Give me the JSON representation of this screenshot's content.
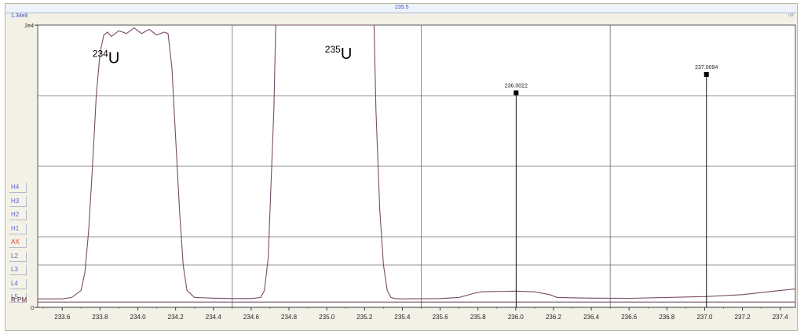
{
  "header": {
    "cursor_mass": "235.5",
    "max_intensity": "1.34e8",
    "corner_mark": "u8"
  },
  "channels": [
    "H4",
    "H3",
    "H2",
    "H1",
    "AX",
    "L2",
    "L3",
    "L4",
    "L5"
  ],
  "rpm_label": "R PM",
  "colors": {
    "trace": "#7a4a6a",
    "peak_line": "#111111",
    "grid": "#6f6f6f",
    "channel_text": "#5a63c9",
    "ax_text": "#e23a2a",
    "label_blue": "#3a4fc6"
  },
  "chart_data": {
    "type": "line",
    "xlabel": "",
    "ylabel": "",
    "xlim": [
      233.47,
      237.48
    ],
    "ylim": [
      0,
      20000.0
    ],
    "y_ticks": [
      {
        "value": 0,
        "label": "0"
      },
      {
        "value": 20000,
        "label": "2e4"
      }
    ],
    "x_ticks": [
      233.6,
      233.8,
      234.0,
      234.2,
      234.4,
      234.6,
      234.8,
      235.0,
      235.2,
      235.4,
      235.6,
      235.8,
      236.0,
      236.2,
      236.4,
      236.6,
      236.8,
      237.0,
      237.2,
      237.4
    ],
    "x_tick_labels": [
      "233.6",
      "233.8",
      "234.0",
      "234.2",
      "234.4",
      "234.6",
      "234.8",
      "235.0",
      "235.2",
      "235.4",
      "235.6",
      "235.8",
      "236.0",
      "236.2",
      "236.4",
      "236.6",
      "236.8",
      "237.0",
      "237.2",
      "237.4"
    ],
    "vertical_grid": [
      234.5,
      235.5,
      236.5
    ],
    "horizontal_grid": [
      3000,
      5000,
      10000,
      15000
    ],
    "grid": true,
    "series": [
      {
        "x": [
          233.47,
          233.6,
          233.65,
          233.7,
          233.72,
          233.74,
          233.76,
          233.78,
          233.8,
          233.82,
          233.84,
          233.86,
          233.9,
          233.94,
          233.98,
          234.02,
          234.06,
          234.1,
          234.14,
          234.16,
          234.18,
          234.2,
          234.22,
          234.24,
          234.26,
          234.3,
          234.4,
          234.5,
          234.6,
          234.65,
          234.67,
          234.69,
          234.7,
          234.72,
          234.73,
          235.25,
          235.26,
          235.28,
          235.3,
          235.32,
          235.34,
          235.36,
          235.4,
          235.6,
          235.7,
          235.78,
          235.82,
          236.0,
          236.1,
          236.18,
          236.22,
          236.4,
          236.6,
          236.8,
          237.0,
          237.2,
          237.4,
          237.48
        ],
        "y": [
          600,
          600,
          700,
          1200,
          2500,
          5500,
          10000,
          15000,
          18000,
          19300,
          19500,
          19200,
          19600,
          19400,
          19800,
          19400,
          19700,
          19300,
          19500,
          19400,
          17000,
          12000,
          7000,
          3000,
          1200,
          700,
          650,
          620,
          620,
          700,
          1200,
          3500,
          7000,
          14000,
          20000,
          20000,
          14000,
          7000,
          3000,
          1200,
          700,
          620,
          600,
          620,
          700,
          1000,
          1100,
          1150,
          1100,
          900,
          700,
          650,
          640,
          700,
          760,
          900,
          1200,
          1300
        ]
      }
    ],
    "peak_markers": [
      {
        "x": 236.0022,
        "y": 15200,
        "label": "236.0022"
      },
      {
        "x": 237.0094,
        "y": 16500,
        "label": "237.0094"
      }
    ],
    "annotations": [
      {
        "sup": "234",
        "base": "U",
        "x": 233.76,
        "y": 17300
      },
      {
        "sup": "235",
        "base": "U",
        "x": 234.99,
        "y": 17600
      }
    ]
  }
}
